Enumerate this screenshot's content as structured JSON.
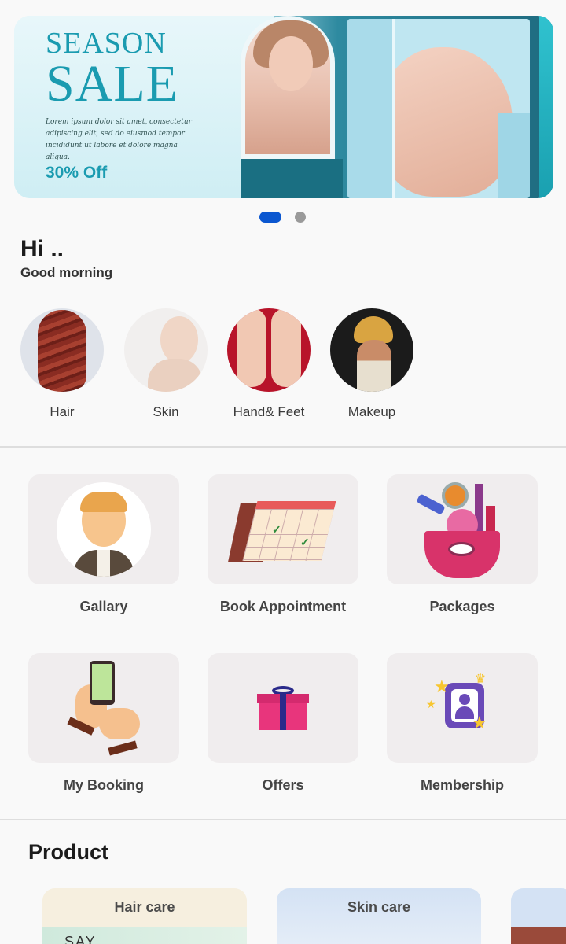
{
  "banner": {
    "title_line1": "SEASON",
    "title_line2": "SALE",
    "body_text": "Lorem ipsum dolor sit amet, consectetur adipiscing elit, sed do eiusmod tempor incididunt ut labore et dolore magna aliqua.",
    "offer": "30% Off",
    "page_indicator": {
      "active": 1,
      "total": 2
    },
    "colors": {
      "accent": "#1a9bb0",
      "dot_active": "#0b57d0",
      "dot_inactive": "#9a9a9a"
    }
  },
  "greeting": {
    "title": "Hi ..",
    "subtitle": "Good morning"
  },
  "categories": [
    {
      "label": "Hair"
    },
    {
      "label": "Skin"
    },
    {
      "label": "Hand& Feet"
    },
    {
      "label": "Makeup"
    }
  ],
  "tiles": [
    {
      "label": "Gallary",
      "icon": "avatar-icon"
    },
    {
      "label": "Book Appointment",
      "icon": "calendar-icon"
    },
    {
      "label": "Packages",
      "icon": "makeup-bag-icon"
    },
    {
      "label": "My Booking",
      "icon": "phone-booking-icon"
    },
    {
      "label": "Offers",
      "icon": "gift-icon"
    },
    {
      "label": "Membership",
      "icon": "membership-card-icon"
    }
  ],
  "product": {
    "title": "Product",
    "cards": [
      {
        "label": "Hair care",
        "image_text": "SAY"
      },
      {
        "label": "Skin care",
        "image_text": ""
      },
      {
        "label": ""
      }
    ]
  }
}
